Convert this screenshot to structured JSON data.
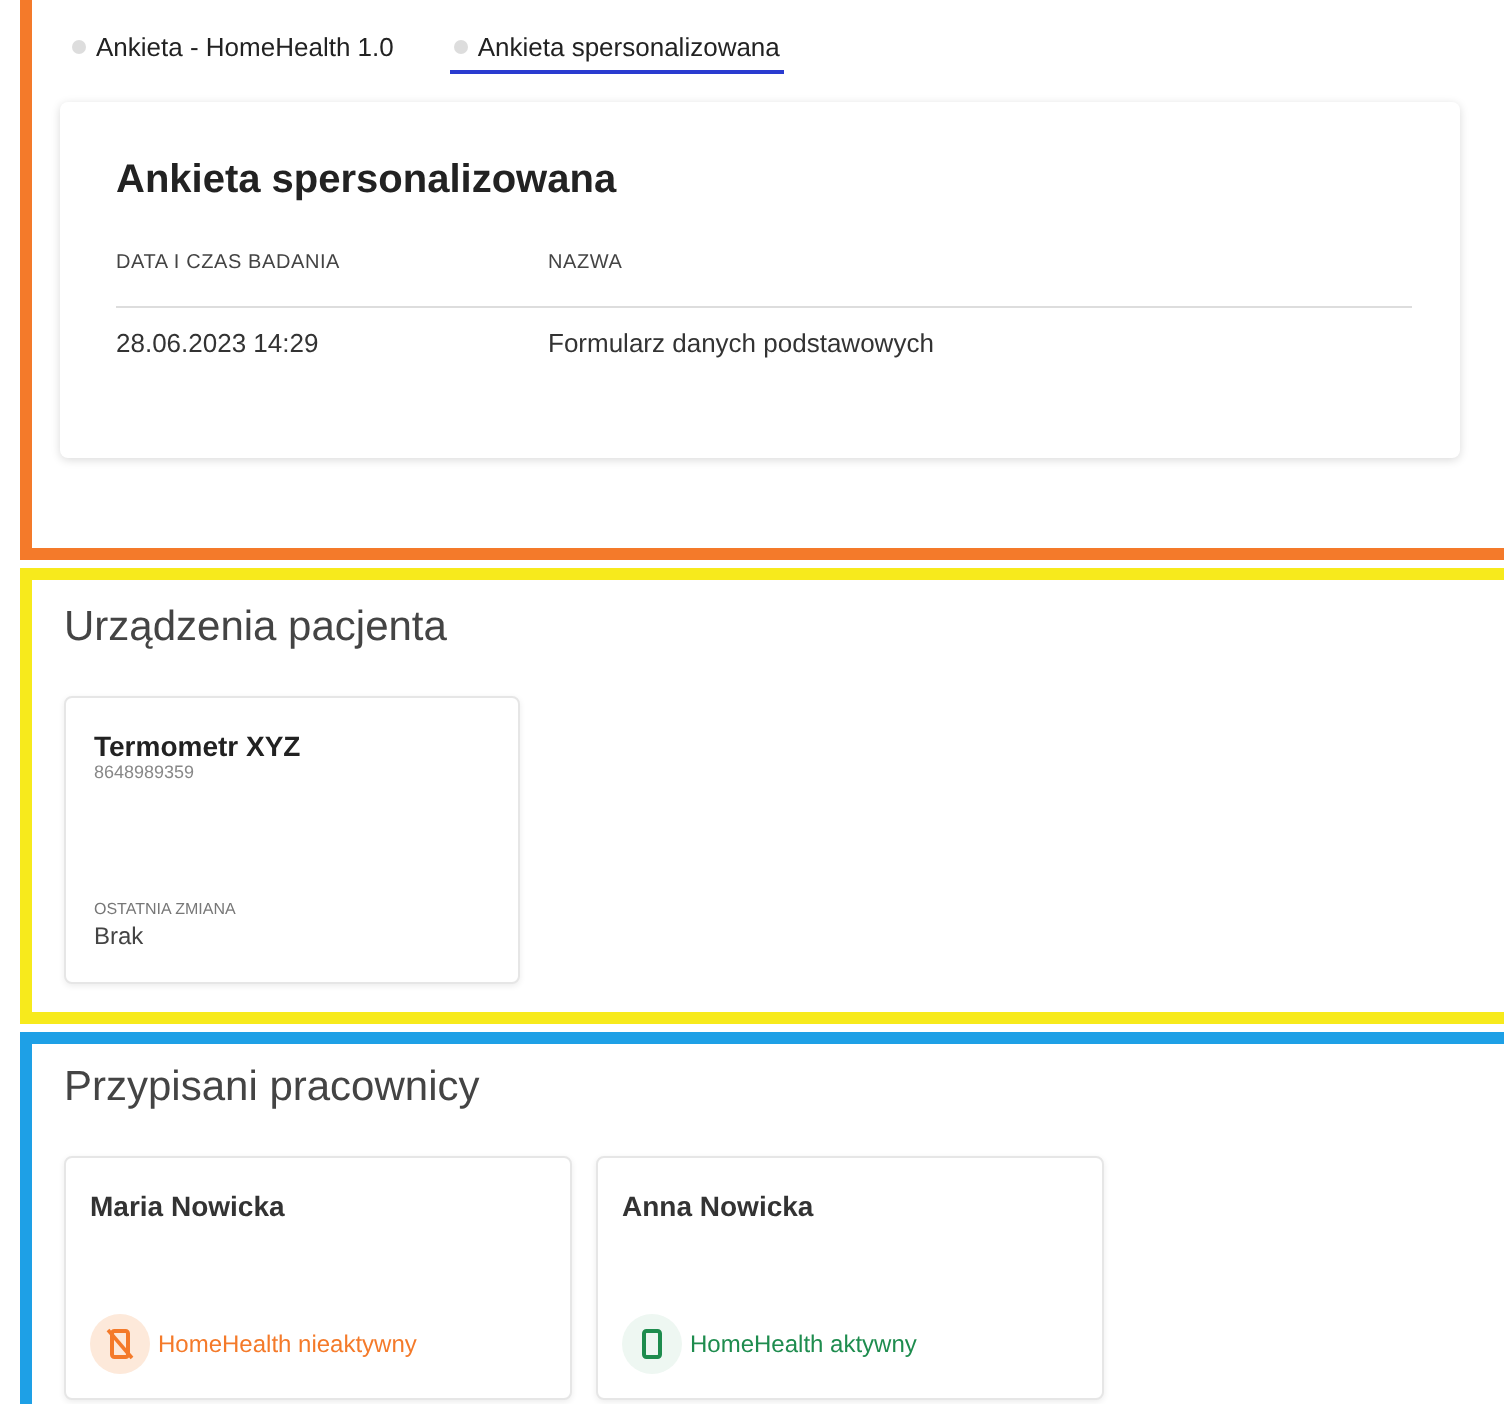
{
  "sections": [
    {
      "kind": "survey",
      "color": "#f47a2a",
      "tabs": [
        {
          "label": "Ankieta - HomeHealth 1.0",
          "selected": false
        },
        {
          "label": "Ankieta spersonalizowana",
          "selected": true
        }
      ],
      "card": {
        "title": "Ankieta spersonalizowana",
        "columns": [
          "DATA I CZAS BADANIA",
          "NAZWA"
        ],
        "rows": [
          [
            "28.06.2023 14:29",
            "Formularz danych podstawowych"
          ]
        ]
      }
    },
    {
      "kind": "devices",
      "color": "#f7ea1c",
      "title": "Urządzenia pacjenta",
      "devices": [
        {
          "name": "Termometr XYZ",
          "serial": "8648989359",
          "change_label": "OSTATNIA ZMIANA",
          "change_value": "Brak"
        }
      ]
    },
    {
      "kind": "staff",
      "color": "#1ea0e6",
      "title": "Przypisani pracownicy",
      "staff": [
        {
          "name": "Maria Nowicka",
          "active": false,
          "status": "HomeHealth nieaktywny"
        },
        {
          "name": "Anna Nowicka",
          "active": true,
          "status": "HomeHealth aktywny"
        }
      ]
    }
  ]
}
